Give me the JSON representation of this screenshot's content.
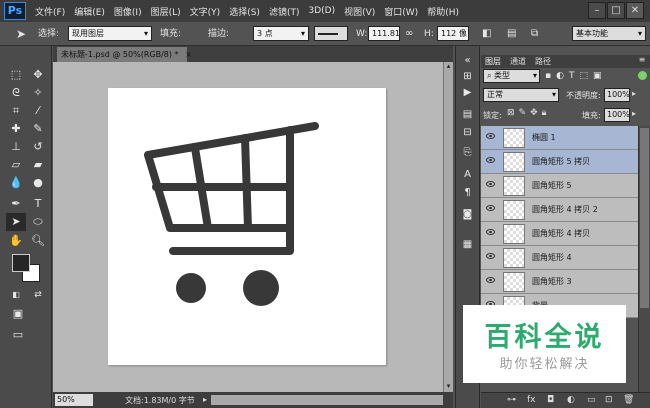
{
  "app": {
    "logo": "Ps"
  },
  "menu": [
    "文件(F)",
    "编辑(E)",
    "图像(I)",
    "图层(L)",
    "文字(Y)",
    "选择(S)",
    "滤镜(T)",
    "3D(D)",
    "视图(V)",
    "窗口(W)",
    "帮助(H)"
  ],
  "window_controls": {
    "minimize": "–",
    "maximize": "□",
    "close": "✕"
  },
  "options": {
    "select_label": "选择:",
    "select_value": "现用图层",
    "fill_label": "填充:",
    "stroke_label": "描边:",
    "stroke_width": "3 点",
    "w_label": "W:",
    "w_value": "111.81",
    "h_label": "H:",
    "h_value": "112 像",
    "workspace": "基本功能"
  },
  "document": {
    "tab_title": "未标题-1.psd @ 50%(RGB/8) *",
    "close": "×",
    "zoom": "50%",
    "doc_size": "文档:1.83M/0 字节"
  },
  "panels": {
    "tabs": [
      "图层",
      "通道",
      "路径"
    ],
    "filter_kind": "类型",
    "blend_mode": "正常",
    "opacity_label": "不透明度:",
    "opacity_value": "100%",
    "lock_label": "锁定:",
    "fill_label": "填充:",
    "fill_value": "100%"
  },
  "layers": [
    {
      "name": "椭圆 1",
      "selected": true
    },
    {
      "name": "圆角矩形 5 拷贝",
      "selected": true
    },
    {
      "name": "圆角矩形 5",
      "selected": false
    },
    {
      "name": "圆角矩形 4 拷贝 2",
      "selected": false
    },
    {
      "name": "圆角矩形 4 拷贝",
      "selected": false
    },
    {
      "name": "圆角矩形 4",
      "selected": false
    },
    {
      "name": "圆角矩形 3",
      "selected": false
    },
    {
      "name": "背景",
      "selected": false
    }
  ],
  "watermark": {
    "title": "百科全说",
    "subtitle": "助你轻松解决"
  },
  "colors": {
    "cart": "#383838",
    "selected_layer": "#a7b6d3",
    "watermark_green": "#2dab6e"
  }
}
